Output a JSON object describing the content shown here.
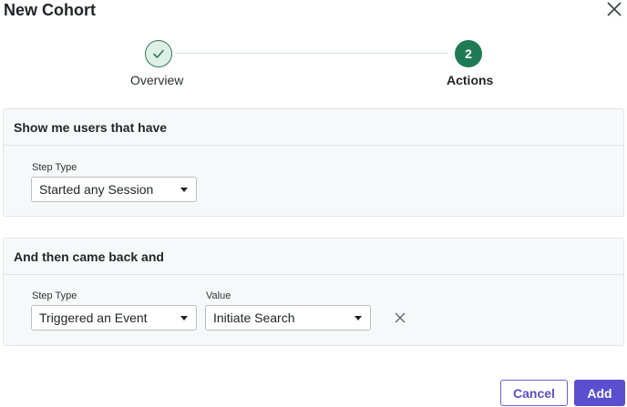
{
  "dialog": {
    "title": "New Cohort"
  },
  "stepper": {
    "steps": [
      {
        "number": "",
        "label": "Overview",
        "state": "complete"
      },
      {
        "number": "2",
        "label": "Actions",
        "state": "active"
      }
    ]
  },
  "section1": {
    "heading": "Show me users that have",
    "step_type_label": "Step Type",
    "step_type_value": "Started any Session"
  },
  "section2": {
    "heading": "And then came back and",
    "step_type_label": "Step Type",
    "step_type_value": "Triggered an Event",
    "value_label": "Value",
    "value_value": "Initiate Search"
  },
  "footer": {
    "cancel_label": "Cancel",
    "add_label": "Add"
  },
  "colors": {
    "accent": "#5b4fd0",
    "success": "#1e7a54"
  }
}
